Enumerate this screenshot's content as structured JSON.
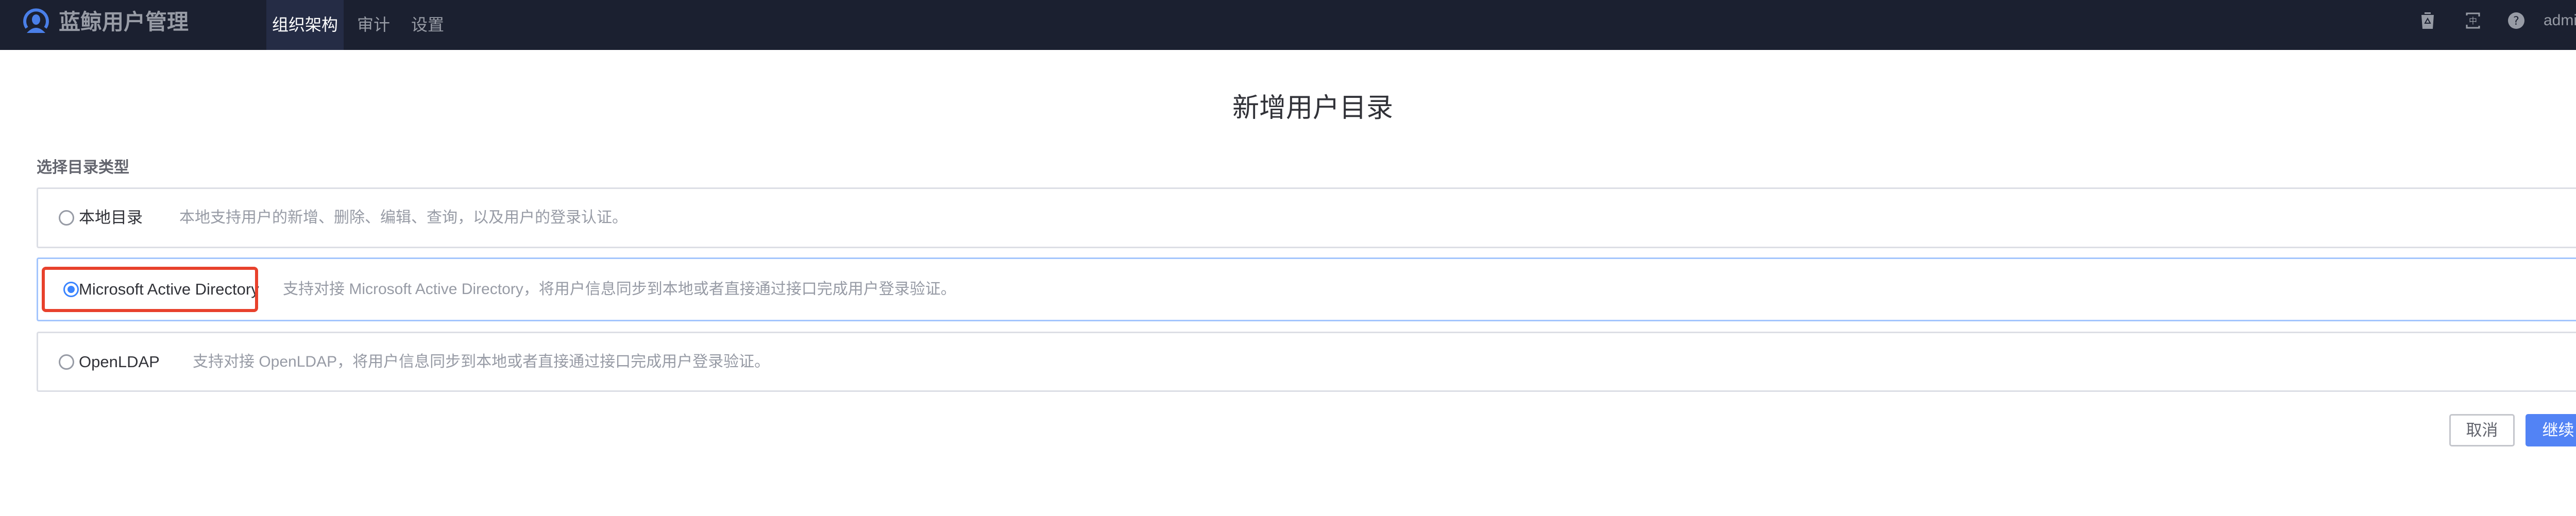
{
  "header": {
    "app_title": "蓝鲸用户管理",
    "nav": [
      {
        "label": "组织架构",
        "active": true
      },
      {
        "label": "审计"
      },
      {
        "label": "设置"
      }
    ],
    "user": "admin",
    "icons": [
      "recycle-bin-icon",
      "language-switch-icon",
      "help-icon"
    ]
  },
  "page": {
    "title": "新增用户目录",
    "section_label": "选择目录类型",
    "options": [
      {
        "label": "本地目录",
        "description": "本地支持用户的新增、删除、编辑、查询，以及用户的登录认证。",
        "selected": false
      },
      {
        "label": "Microsoft Active Directory",
        "description": "支持对接 Microsoft Active Directory，将用户信息同步到本地或者直接通过接口完成用户登录验证。",
        "selected": true
      },
      {
        "label": "OpenLDAP",
        "description": "支持对接 OpenLDAP，将用户信息同步到本地或者直接通过接口完成用户登录验证。",
        "selected": false
      }
    ],
    "cancel": "取消",
    "continue": "继续"
  },
  "colors": {
    "accent": "#3a84ff",
    "primary_button": "#5283f5",
    "nav_bg": "#1b2030",
    "highlight": "#e8412c"
  }
}
